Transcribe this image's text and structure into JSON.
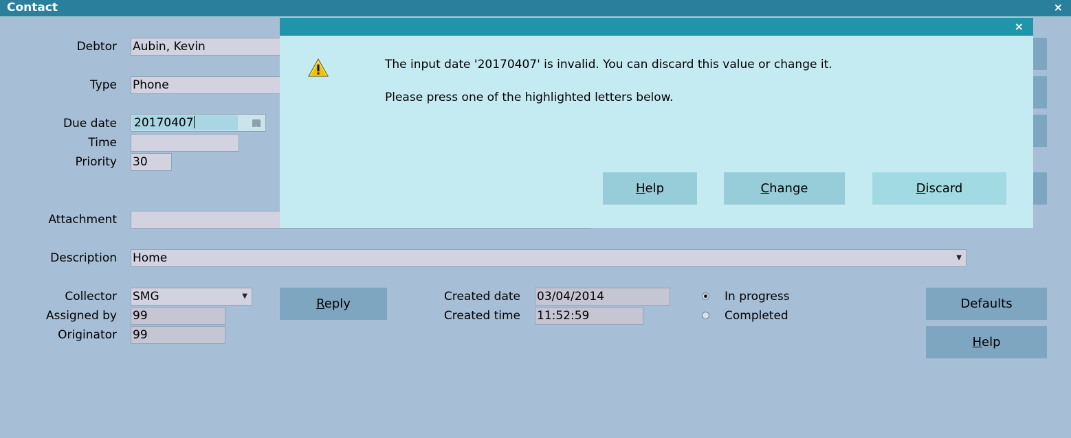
{
  "window": {
    "title": "Contact",
    "close_glyph": "×"
  },
  "form": {
    "debtor": {
      "label": "Debtor",
      "value": "Aubin, Kevin"
    },
    "type": {
      "label": "Type",
      "value": "Phone"
    },
    "due_date": {
      "label": "Due date",
      "value": "20170407",
      "picker_icon": "calendar-icon"
    },
    "time": {
      "label": "Time",
      "value": ""
    },
    "priority": {
      "label": "Priority",
      "value": "30"
    },
    "attachment": {
      "label": "Attachment",
      "value": ""
    },
    "description": {
      "label": "Description",
      "value": "Home"
    },
    "collector": {
      "label": "Collector",
      "value": "SMG"
    },
    "assigned_by": {
      "label": "Assigned by",
      "value": "99"
    },
    "originator": {
      "label": "Originator",
      "value": "99"
    },
    "created_date": {
      "label": "Created date",
      "value": "03/04/2014"
    },
    "created_time": {
      "label": "Created time",
      "value": "11:52:59"
    },
    "status": {
      "options": [
        {
          "label": "In progress",
          "selected": true
        },
        {
          "label": "Completed",
          "selected": false
        }
      ]
    }
  },
  "buttons": {
    "reply": {
      "mnemonic": "R",
      "rest": "eply"
    },
    "defaults": {
      "label": "Defaults"
    },
    "help": {
      "mnemonic": "H",
      "rest": "elp"
    }
  },
  "dialog": {
    "close_glyph": "×",
    "icon": "warning-icon",
    "message_line1": "The input date '20170407' is invalid.  You can discard this value or change it.",
    "message_line2": "Please press one of the highlighted letters below.",
    "buttons": {
      "help": {
        "mnemonic": "H",
        "rest": "elp"
      },
      "change": {
        "mnemonic": "C",
        "rest": "hange"
      },
      "discard": {
        "mnemonic": "D",
        "rest": "iscard"
      }
    }
  },
  "colors": {
    "background": "#a6bfd6",
    "titlebar": "#2a7f9d",
    "dialog_bar": "#1f94ab",
    "dialog_bg": "#c5ebf2",
    "button": "#7fa6c1"
  }
}
